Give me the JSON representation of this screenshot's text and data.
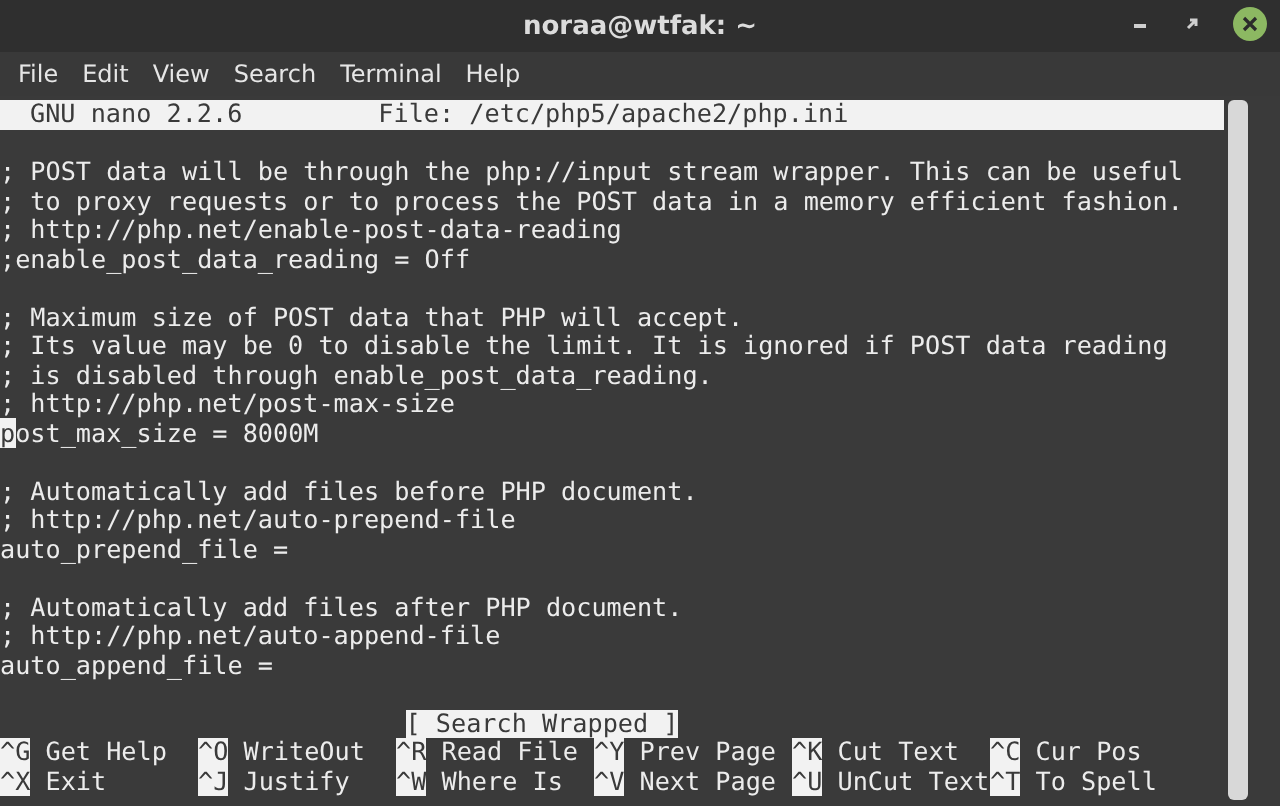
{
  "window": {
    "title": "noraa@wtfak: ~"
  },
  "menu": [
    "File",
    "Edit",
    "View",
    "Search",
    "Terminal",
    "Help"
  ],
  "nano_header": {
    "version": "GNU nano 2.2.6",
    "file": "File: /etc/php5/apache2/php.ini"
  },
  "lines": [
    {
      "kind": "blank"
    },
    {
      "kind": "text",
      "text": "; POST data will be through the php://input stream wrapper. This can be useful",
      "cursor": false
    },
    {
      "kind": "text",
      "text": "; to proxy requests or to process the POST data in a memory efficient fashion.",
      "cursor": false
    },
    {
      "kind": "text",
      "text": "; http://php.net/enable-post-data-reading",
      "cursor": false
    },
    {
      "kind": "text",
      "text": ";enable_post_data_reading = Off",
      "cursor": false
    },
    {
      "kind": "blank"
    },
    {
      "kind": "text",
      "text": "; Maximum size of POST data that PHP will accept.",
      "cursor": false
    },
    {
      "kind": "text",
      "text": "; Its value may be 0 to disable the limit. It is ignored if POST data reading",
      "cursor": false
    },
    {
      "kind": "text",
      "text": "; is disabled through enable_post_data_reading.",
      "cursor": false
    },
    {
      "kind": "text",
      "text": "; http://php.net/post-max-size",
      "cursor": false
    },
    {
      "kind": "text",
      "text": "post_max_size = 8000M",
      "cursor": true
    },
    {
      "kind": "blank"
    },
    {
      "kind": "text",
      "text": "; Automatically add files before PHP document.",
      "cursor": false
    },
    {
      "kind": "text",
      "text": "; http://php.net/auto-prepend-file",
      "cursor": false
    },
    {
      "kind": "text",
      "text": "auto_prepend_file =",
      "cursor": false
    },
    {
      "kind": "blank"
    },
    {
      "kind": "text",
      "text": "; Automatically add files after PHP document.",
      "cursor": false
    },
    {
      "kind": "text",
      "text": "; http://php.net/auto-append-file",
      "cursor": false
    },
    {
      "kind": "text",
      "text": "auto_append_file =",
      "cursor": false
    },
    {
      "kind": "blank"
    }
  ],
  "status": "[ Search Wrapped ]",
  "shortcuts": [
    [
      {
        "key": "^G",
        "label": "Get Help"
      },
      {
        "key": "^O",
        "label": "WriteOut"
      },
      {
        "key": "^R",
        "label": "Read File"
      },
      {
        "key": "^Y",
        "label": "Prev Page"
      },
      {
        "key": "^K",
        "label": "Cut Text"
      },
      {
        "key": "^C",
        "label": "Cur Pos"
      }
    ],
    [
      {
        "key": "^X",
        "label": "Exit"
      },
      {
        "key": "^J",
        "label": "Justify"
      },
      {
        "key": "^W",
        "label": "Where Is"
      },
      {
        "key": "^V",
        "label": "Next Page"
      },
      {
        "key": "^U",
        "label": "UnCut Text"
      },
      {
        "key": "^T",
        "label": "To Spell"
      }
    ]
  ]
}
